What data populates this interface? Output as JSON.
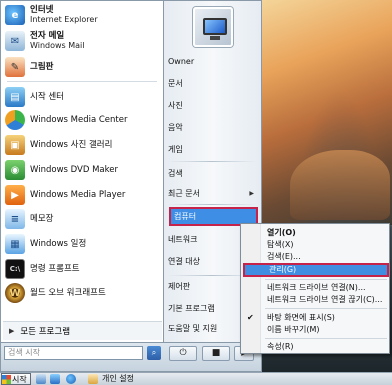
{
  "left_items": [
    {
      "name": "인터넷",
      "sub": "Internet Explorer"
    },
    {
      "name": "전자 메일",
      "sub": "Windows Mail"
    },
    {
      "name": "그림판"
    },
    {
      "name": "시작 센터"
    },
    {
      "name": "Windows Media Center"
    },
    {
      "name": "Windows 사진 갤러리"
    },
    {
      "name": "Windows DVD Maker"
    },
    {
      "name": "Windows Media Player"
    },
    {
      "name": "메모장"
    },
    {
      "name": "Windows 일정"
    },
    {
      "name": "명령 프롬프트"
    },
    {
      "name": "월드 오브 워크래프트"
    }
  ],
  "all_programs": "모든 프로그램",
  "search_placeholder": "검색 시작",
  "right_items": {
    "owner": "Owner",
    "documents": "문서",
    "pictures": "사진",
    "music": "음악",
    "games": "게임",
    "search": "검색",
    "recent": "최근 문서",
    "computer": "컴퓨터",
    "network": "네트워크",
    "connect": "연결 대상",
    "control_panel": "제어판",
    "default_programs": "기본 프로그램",
    "help": "도움말 및 지원"
  },
  "context_menu": {
    "open": "열기(O)",
    "explore": "탐색(X)",
    "search": "검색(E)...",
    "manage": "관리(G)",
    "map_drive": "네트워크 드라이브 연결(N)...",
    "disconnect_drive": "네트워크 드라이브 연결 끊기(C)...",
    "show_desktop": "바탕 화면에 표시(S)",
    "rename": "이름 바꾸기(M)",
    "properties": "속성(R)"
  },
  "taskbar": {
    "start": "시작",
    "task": "개인 설정"
  }
}
